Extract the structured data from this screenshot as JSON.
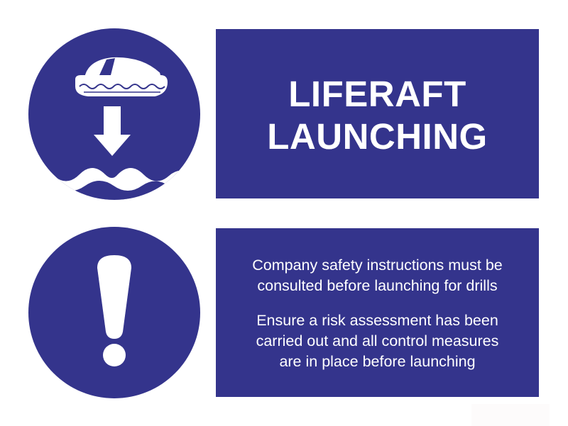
{
  "colors": {
    "sign_blue": "#34348c",
    "foreground": "#ffffff"
  },
  "icons": {
    "top": "liferaft-launching-icon",
    "bottom": "exclamation-mark-icon"
  },
  "title": {
    "line1": "LIFERAFT",
    "line2": "LAUNCHING"
  },
  "info": {
    "paragraph1": {
      "line1": "Company safety instructions must be",
      "line2": "consulted before launching for drills"
    },
    "paragraph2": {
      "line1": "Ensure a risk assessment has been",
      "line2": "carried out and all control measures",
      "line3": "are in place before launching"
    }
  }
}
